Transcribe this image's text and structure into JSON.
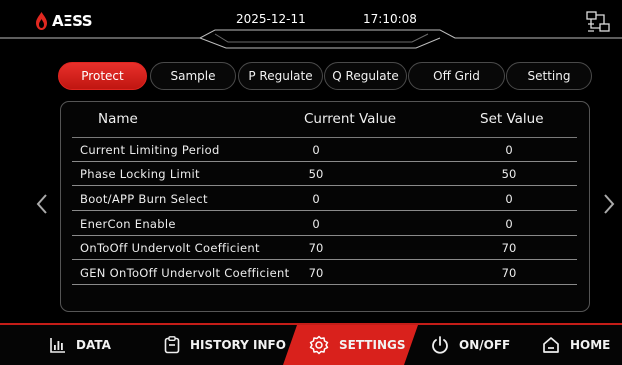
{
  "header": {
    "brand": "AΞSS",
    "date": "2025-12-11",
    "time": "17:10:08"
  },
  "tabs": [
    {
      "label": "Protect",
      "active": true
    },
    {
      "label": "Sample",
      "active": false
    },
    {
      "label": "P Regulate",
      "active": false
    },
    {
      "label": "Q Regulate",
      "active": false
    },
    {
      "label": "Off Grid",
      "active": false
    },
    {
      "label": "Setting",
      "active": false
    }
  ],
  "table": {
    "headers": [
      "Name",
      "Current Value",
      "Set Value"
    ],
    "rows": [
      {
        "name": "Current Limiting Period",
        "current": "0",
        "set": "0"
      },
      {
        "name": "Phase Locking Limit",
        "current": "50",
        "set": "50"
      },
      {
        "name": "Boot/APP Burn Select",
        "current": "0",
        "set": "0"
      },
      {
        "name": "EnerCon Enable",
        "current": "0",
        "set": "0"
      },
      {
        "name": "OnToOff Undervolt Coefficient",
        "current": "70",
        "set": "70"
      },
      {
        "name": "GEN OnToOff Undervolt Coefficient",
        "current": "70",
        "set": "70"
      }
    ]
  },
  "nav": {
    "data": "DATA",
    "history": "HISTORY INFO",
    "settings": "SETTINGS",
    "onoff": "ON/OFF",
    "home": "HOME"
  },
  "colors": {
    "accent": "#d9211c",
    "background": "#000000",
    "border": "#555555"
  },
  "icons": [
    "aess-logo-icon",
    "network-icon",
    "chevron-left-icon",
    "chevron-right-icon",
    "bar-chart-icon",
    "clipboard-icon",
    "gear-icon",
    "power-icon",
    "home-icon"
  ]
}
